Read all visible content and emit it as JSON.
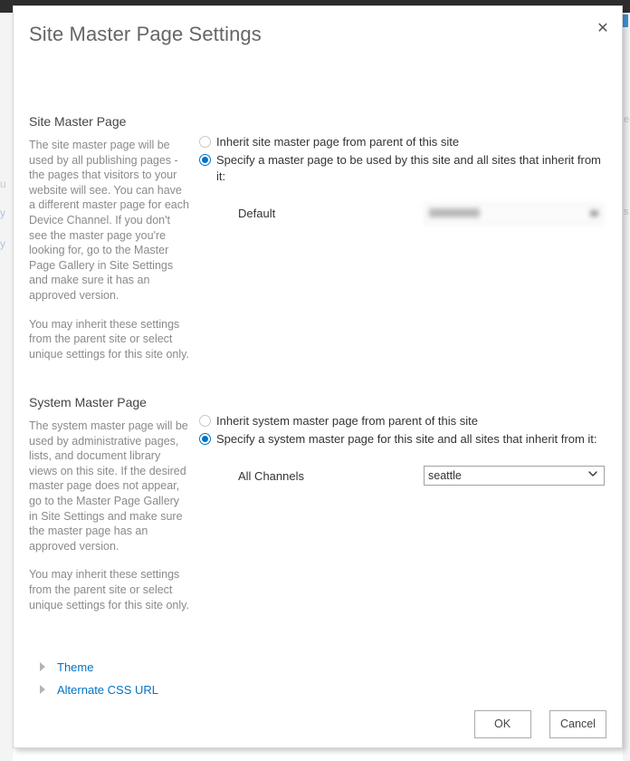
{
  "dialog": {
    "title": "Site Master Page Settings",
    "close_label": "✕",
    "close_icon": "close-icon"
  },
  "sections": [
    {
      "id": "site-master-page",
      "heading": "Site Master Page",
      "description": [
        "The site master page will be used by all publishing pages - the pages that visitors to your website will see. You can have a different master page for each Device Channel. If you don't see the master page you're looking for, go to the Master Page Gallery in Site Settings and make sure it has an approved version.",
        "You may inherit these settings from the parent site or select unique settings for this site only."
      ],
      "options": [
        {
          "label": "Inherit site master page from parent of this site",
          "checked": false
        },
        {
          "label": "Specify a master page to be used by this site and all sites that inherit from it:",
          "checked": true
        }
      ],
      "field": {
        "label": "Default",
        "control": "dropdown",
        "redacted": true,
        "value": ""
      }
    },
    {
      "id": "system-master-page",
      "heading": "System Master Page",
      "description": [
        "The system master page will be used by administrative pages, lists, and document library views on this site. If the desired master page does not appear, go to the Master Page Gallery in Site Settings and make sure the master page has an approved version.",
        "You may inherit these settings from the parent site or select unique settings for this site only."
      ],
      "options": [
        {
          "label": "Inherit system master page from parent of this site",
          "checked": false
        },
        {
          "label": "Specify a system master page for this site and all sites that inherit from it:",
          "checked": true
        }
      ],
      "field": {
        "label": "All Channels",
        "control": "dropdown",
        "redacted": false,
        "value": "seattle",
        "options": [
          "seattle"
        ]
      }
    }
  ],
  "expanders": [
    {
      "label": "Theme",
      "icon": "chevron-right-icon",
      "expanded": false
    },
    {
      "label": "Alternate CSS URL",
      "icon": "chevron-right-icon",
      "expanded": false
    }
  ],
  "footer": {
    "ok_label": "OK",
    "cancel_label": "Cancel"
  },
  "colors": {
    "accent": "#0072c6",
    "link": "#0072c6",
    "heading_text": "#444444",
    "description_text": "#8a8a8a",
    "suite_bar": "#2d2d2d",
    "dialog_border": "#d6d6d6"
  }
}
